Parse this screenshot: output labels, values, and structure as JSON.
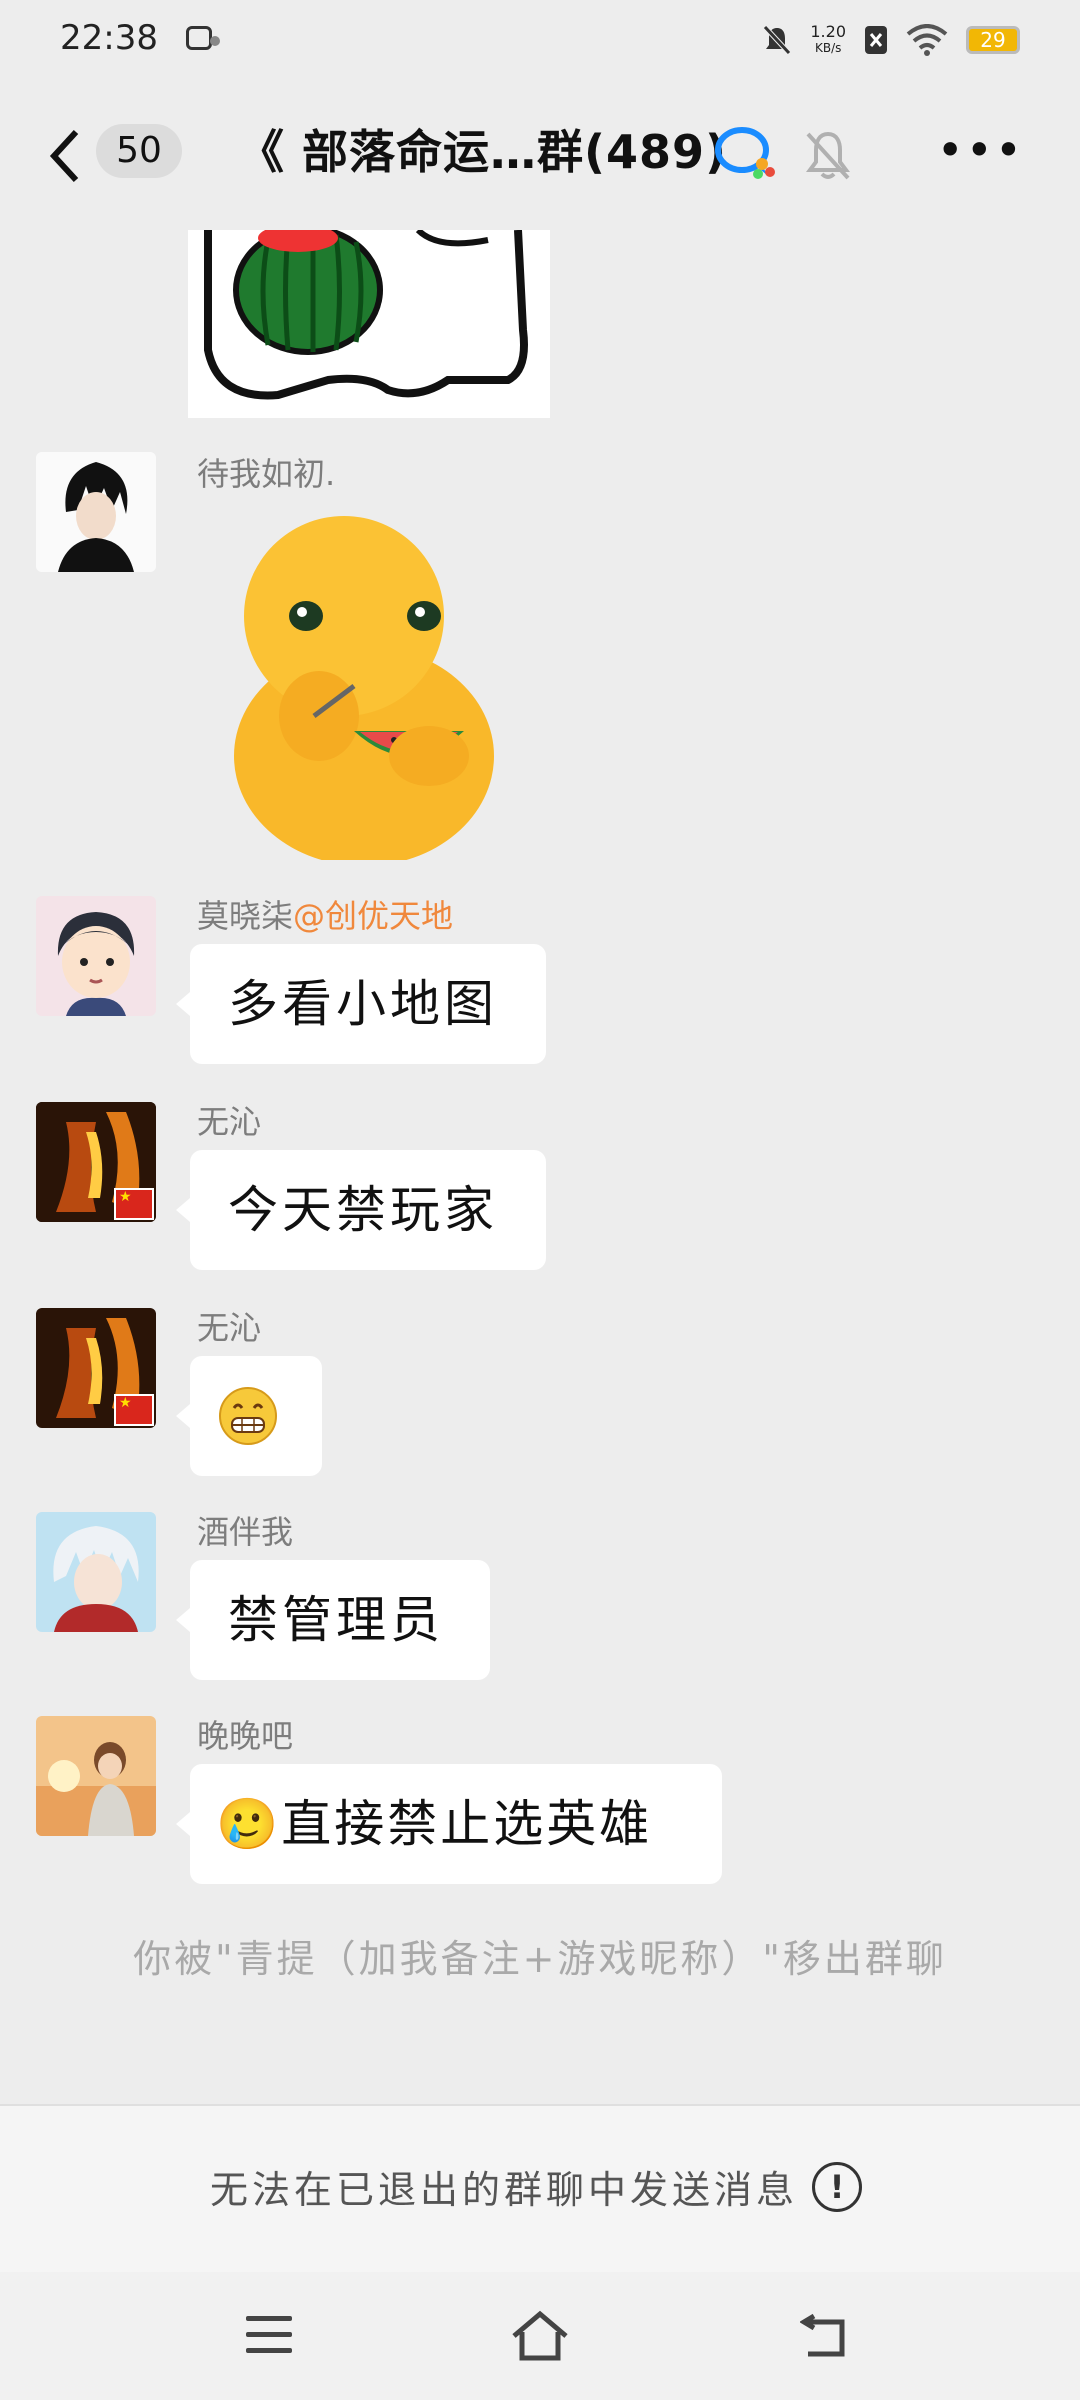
{
  "status_bar": {
    "time": "22:38",
    "net_speed_value": "1.20",
    "net_speed_unit": "KB/s",
    "battery": "29",
    "icons": [
      "app-notification-icon",
      "mute-bell-icon",
      "sim-off-icon",
      "wifi-icon",
      "battery-icon"
    ]
  },
  "header": {
    "back_icon": "chevron-left-icon",
    "unread_count": "50",
    "title": "《 部落命运…群(489)",
    "chat_icon": "group-chat-icon",
    "mute_icon": "bell-off-icon",
    "more_icon": "more-horizontal-icon",
    "more_label": "•••"
  },
  "messages": [
    {
      "type": "sticker",
      "description_icon": "watermelon-cartoon-sticker"
    },
    {
      "type": "sticker",
      "sender": "待我如初.",
      "avatar": "black-hair-anime-boy-avatar",
      "description_icon": "yellow-creature-eating-watermelon-sticker"
    },
    {
      "type": "text",
      "sender": "莫晓柒",
      "mention": "@创优天地",
      "text": "多看小地图",
      "avatar": "cartoon-boy-avatar"
    },
    {
      "type": "text",
      "sender": "无沁",
      "text": "今天禁玩家",
      "avatar": "fire-avatar"
    },
    {
      "type": "emoji",
      "sender": "无沁",
      "text": "😁",
      "avatar": "fire-avatar"
    },
    {
      "type": "text",
      "sender": "酒伴我",
      "text": "禁管理员",
      "avatar": "white-hair-anime-avatar"
    },
    {
      "type": "text",
      "sender": "晚晚吧",
      "text": "🥲直接禁止选英雄",
      "avatar": "sunset-boy-avatar"
    }
  ],
  "system_message": "你被\"青提（加我备注+游戏昵称）\"移出群聊",
  "footer": {
    "exited_notice": "无法在已退出的群聊中发送消息",
    "alert_icon_label": "!"
  },
  "android_nav": {
    "icons": [
      "menu-icon",
      "home-icon",
      "back-icon"
    ]
  },
  "colors": {
    "background": "#ededed",
    "bubble": "#ffffff",
    "mention": "#f0883c",
    "sender_name": "#7d7d7d"
  }
}
